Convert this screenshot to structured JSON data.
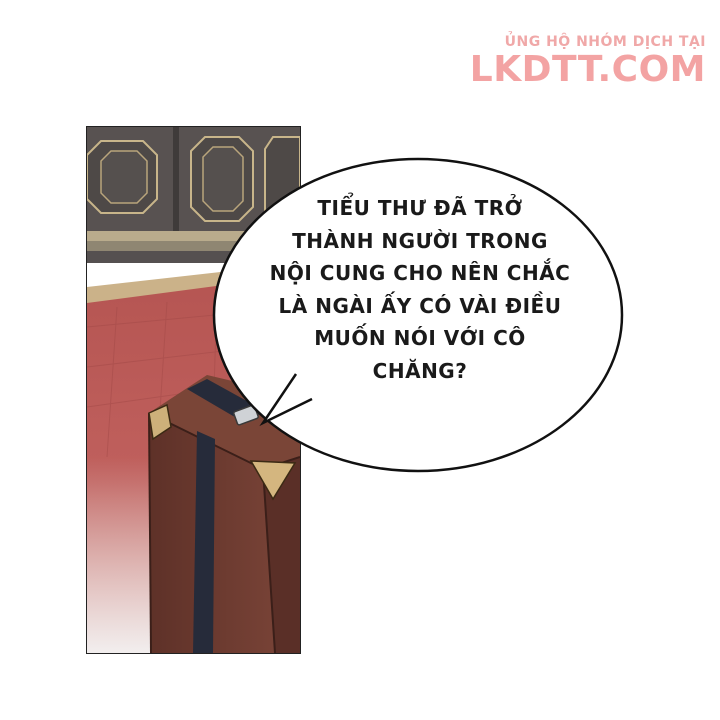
{
  "watermark": {
    "line1": "ỦNG HỘ NHÓM DỊCH TẠI",
    "line2": "LKDTT.COM"
  },
  "speech_bubble": {
    "lines": [
      "TIỂU THƯ ĐÃ TRỞ",
      "THÀNH NGƯỜI TRONG",
      "NỘI CUNG CHO NÊN CHẮC",
      "LÀ NGÀI ẤY CÓ VÀI ĐIỀU",
      "MUỐN NÓI VỚI CÔ",
      "CHĂNG?"
    ]
  },
  "colors": {
    "wall": "#5a5553",
    "carpet": "#b55a58",
    "case": "#6b3a30",
    "strap": "#252a38",
    "corner": "#c9ad78"
  }
}
